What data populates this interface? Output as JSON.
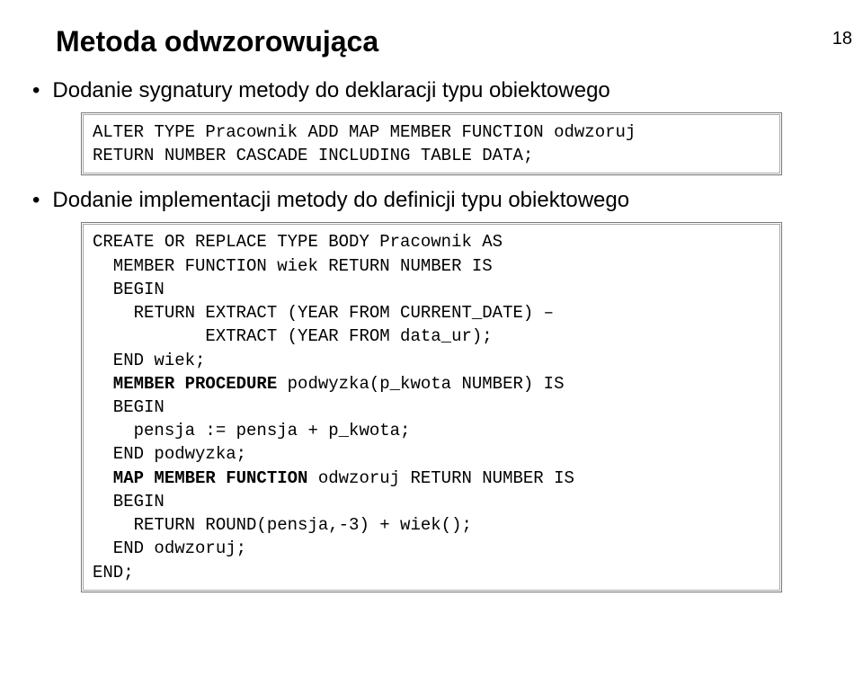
{
  "page_number": "18",
  "title": "Metoda odwzorowująca",
  "bullet1": "Dodanie sygnatury metody do deklaracji typu obiektowego",
  "bullet2": "Dodanie implementacji metody do definicji typu obiektowego",
  "code1_line1": "ALTER TYPE Pracownik ADD MAP MEMBER FUNCTION odwzoruj",
  "code1_line2": "RETURN NUMBER CASCADE INCLUDING TABLE DATA;",
  "code2_line1": "CREATE OR REPLACE TYPE BODY Pracownik AS",
  "code2_line2": "  MEMBER FUNCTION wiek RETURN NUMBER IS",
  "code2_line3": "  BEGIN",
  "code2_line4": "    RETURN EXTRACT (YEAR FROM CURRENT_DATE) –",
  "code2_line5": "           EXTRACT (YEAR FROM data_ur);",
  "code2_line6": "  END wiek;",
  "code2_line7a": "  MEMBER PROCEDURE",
  "code2_line7b": " podwyzka(p_kwota NUMBER) IS",
  "code2_line8": "  BEGIN",
  "code2_line9": "    pensja := pensja + p_kwota;",
  "code2_line10": "  END podwyzka;",
  "code2_line11a": "  MAP MEMBER FUNCTION",
  "code2_line11b": " odwzoruj RETURN NUMBER IS",
  "code2_line12": "  BEGIN",
  "code2_line13": "    RETURN ROUND(pensja,-3) + wiek();",
  "code2_line14": "  END odwzoruj;",
  "code2_line15": "END;"
}
